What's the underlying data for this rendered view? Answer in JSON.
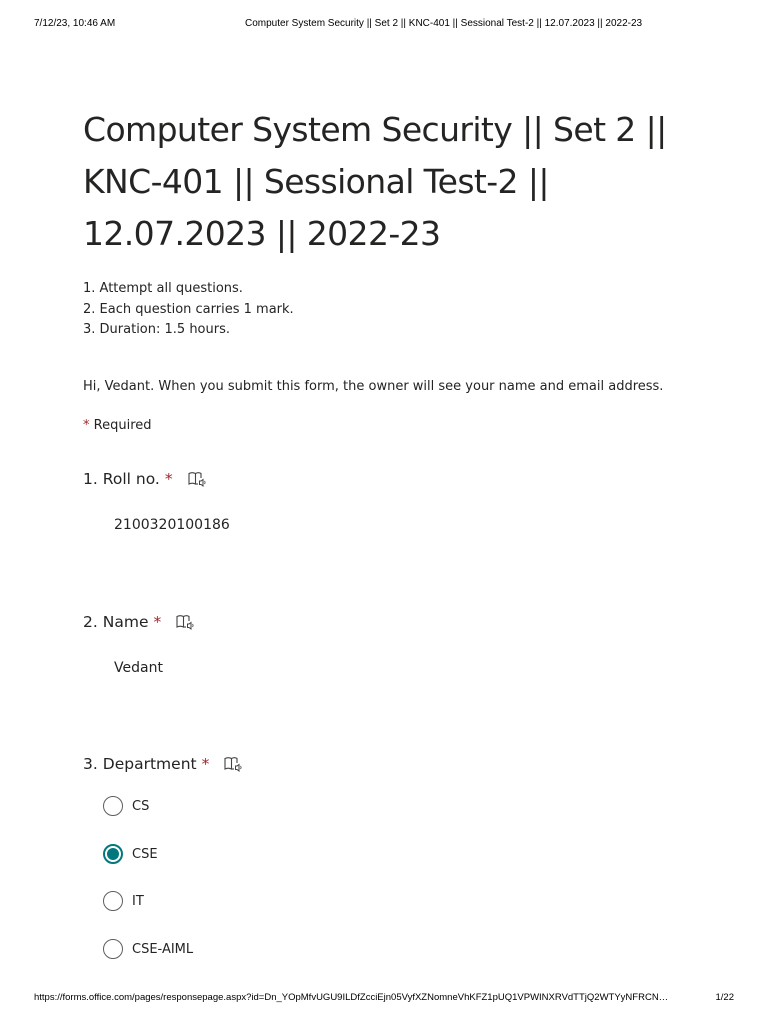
{
  "print_header": {
    "datetime": "7/12/23, 10:46 AM",
    "title": "Computer System Security || Set 2 || KNC-401 || Sessional Test-2 || 12.07.2023 || 2022-23"
  },
  "form": {
    "title": "Computer System Security || Set 2 || KNC-401 || Sessional Test-2 || 12.07.2023 || 2022-23",
    "description": [
      "1. Attempt all questions.",
      "2. Each question carries 1 mark.",
      "3. Duration: 1.5 hours."
    ],
    "notice": "Hi, Vedant. When you submit this form, the owner will see your name and email address.",
    "required_marker": "*",
    "required_label": "Required"
  },
  "questions": [
    {
      "number": "1.",
      "label": "Roll no.",
      "required_marker": "*",
      "icon": "immersive-reader-icon",
      "answer": "2100320100186"
    },
    {
      "number": "2.",
      "label": "Name",
      "required_marker": "*",
      "icon": "immersive-reader-icon",
      "answer": "Vedant"
    },
    {
      "number": "3.",
      "label": "Department",
      "required_marker": "*",
      "icon": "immersive-reader-icon",
      "options": [
        {
          "label": "CS",
          "selected": false
        },
        {
          "label": "CSE",
          "selected": true
        },
        {
          "label": "IT",
          "selected": false
        },
        {
          "label": "CSE-AIML",
          "selected": false
        }
      ]
    }
  ],
  "colors": {
    "accent": "#03787c",
    "required": "#a4262c",
    "text": "#242424"
  },
  "print_footer": {
    "url": "https://forms.office.com/pages/responsepage.aspx?id=Dn_YOpMfvUGU9ILDfZcciEjn05VyfXZNomneVhKFZ1pUQ1VPWINXRVdTTjQ2WTYyNFRCN…",
    "page_indicator": "1/22"
  }
}
